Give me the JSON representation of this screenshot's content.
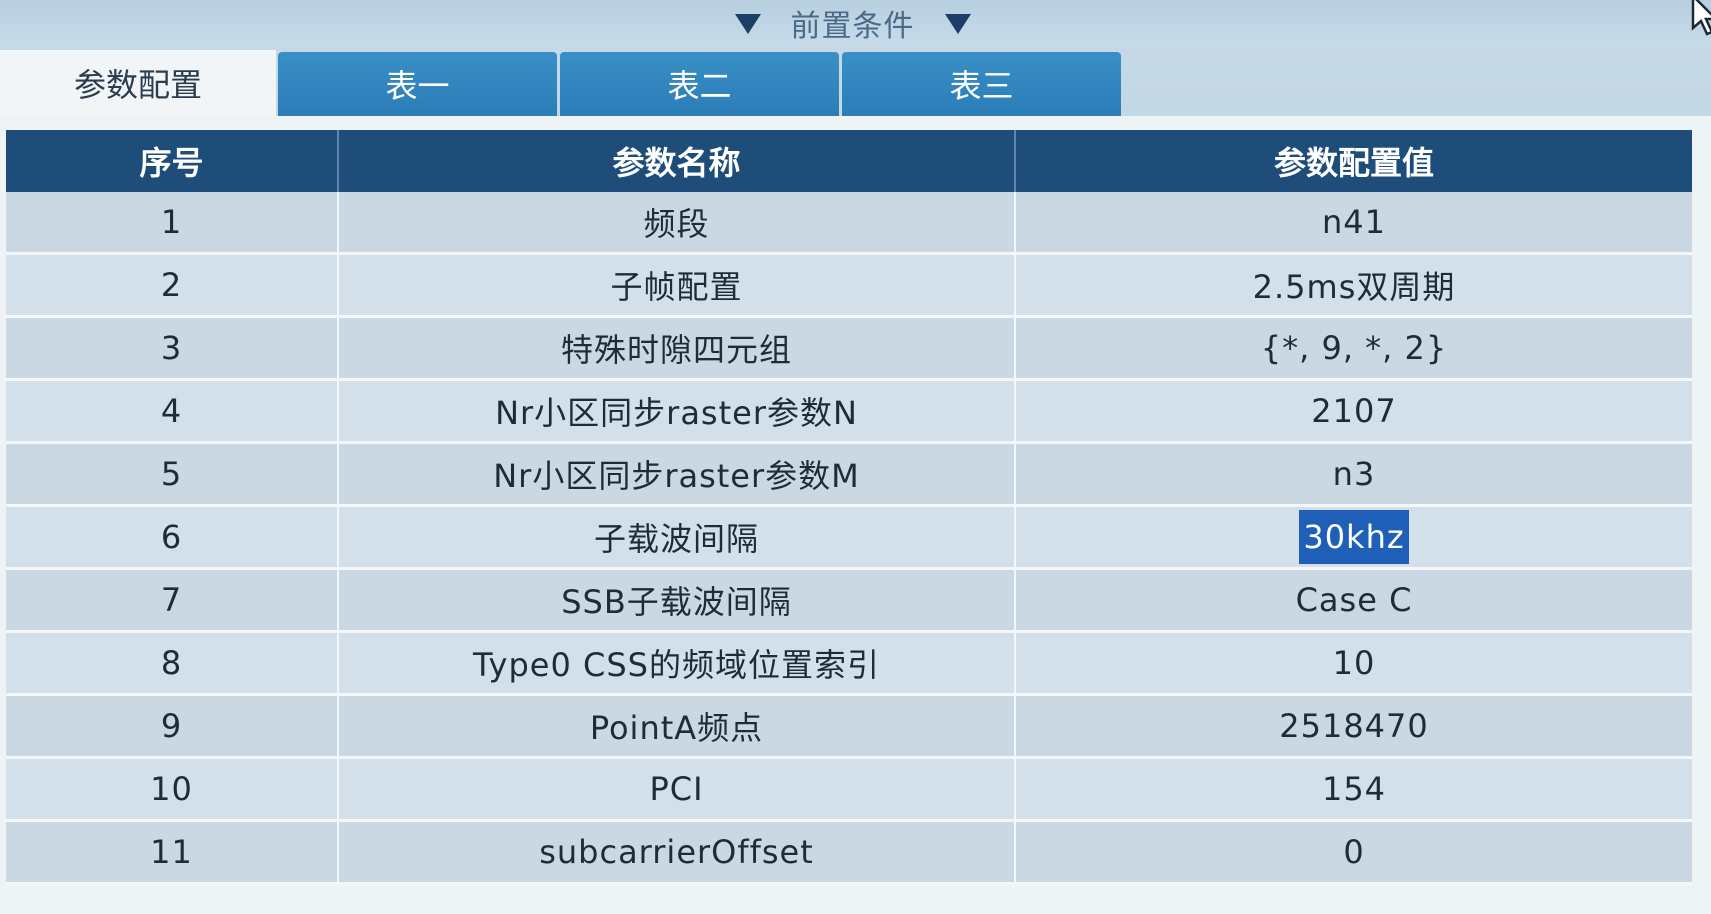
{
  "precondition": {
    "label": "前置条件"
  },
  "tabs": [
    {
      "label": "参数配置",
      "active": true
    },
    {
      "label": "表一",
      "active": false
    },
    {
      "label": "表二",
      "active": false
    },
    {
      "label": "表三",
      "active": false
    }
  ],
  "table": {
    "headers": [
      "序号",
      "参数名称",
      "参数配置值"
    ],
    "rows": [
      {
        "index": "1",
        "name": "频段",
        "value": "n41"
      },
      {
        "index": "2",
        "name": "子帧配置",
        "value": "2.5ms双周期"
      },
      {
        "index": "3",
        "name": "特殊时隙四元组",
        "value": "{*, 9, *, 2}"
      },
      {
        "index": "4",
        "name": "Nr小区同步raster参数N",
        "value": "2107"
      },
      {
        "index": "5",
        "name": "Nr小区同步raster参数M",
        "value": "n3"
      },
      {
        "index": "6",
        "name": "子载波间隔",
        "value": "30khz"
      },
      {
        "index": "7",
        "name": "SSB子载波间隔",
        "value": "Case C"
      },
      {
        "index": "8",
        "name": "Type0 CSS的频域位置索引",
        "value": "10"
      },
      {
        "index": "9",
        "name": "PointA频点",
        "value": "2518470"
      },
      {
        "index": "10",
        "name": "PCI",
        "value": "154"
      },
      {
        "index": "11",
        "name": "subcarrierOffset",
        "value": "0"
      }
    ],
    "selected_row": 5
  },
  "colors": {
    "header_bg": "#1f4d7a",
    "tab_active_bg": "#f1f5f8",
    "tab_inactive_bg": "#2b7db8",
    "selection_bg": "#1f5fb8"
  }
}
